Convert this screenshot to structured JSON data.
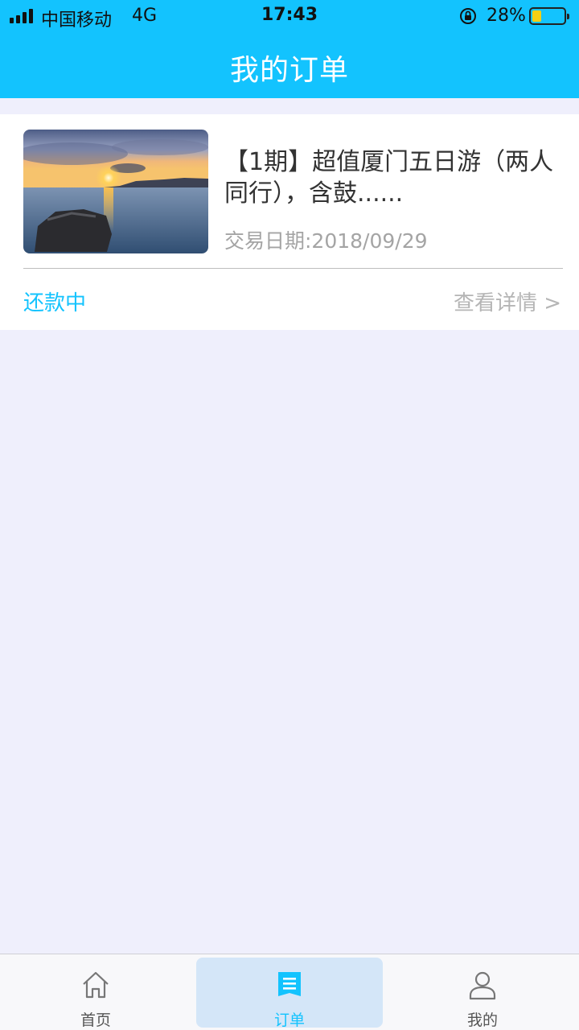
{
  "status_bar": {
    "carrier": "中国移动",
    "network": "4G",
    "time": "17:43",
    "battery_percent": "28%",
    "battery_level": 0.28
  },
  "header": {
    "title": "我的订单"
  },
  "order": {
    "title": "【1期】超值厦门五日游（两人同行），含鼓......",
    "date": "交易日期:2018/09/29",
    "status": "还款中",
    "detail_link": "查看详情 >",
    "image": "sunset-sea-photo"
  },
  "tab_bar": {
    "tabs": [
      {
        "label": "首页",
        "icon": "home-icon",
        "active": false
      },
      {
        "label": "订单",
        "icon": "order-icon",
        "active": true
      },
      {
        "label": "我的",
        "icon": "user-icon",
        "active": false
      }
    ]
  },
  "colors": {
    "accent": "#13c3fe",
    "background": "#efeffc",
    "battery": "#f5cf13"
  }
}
